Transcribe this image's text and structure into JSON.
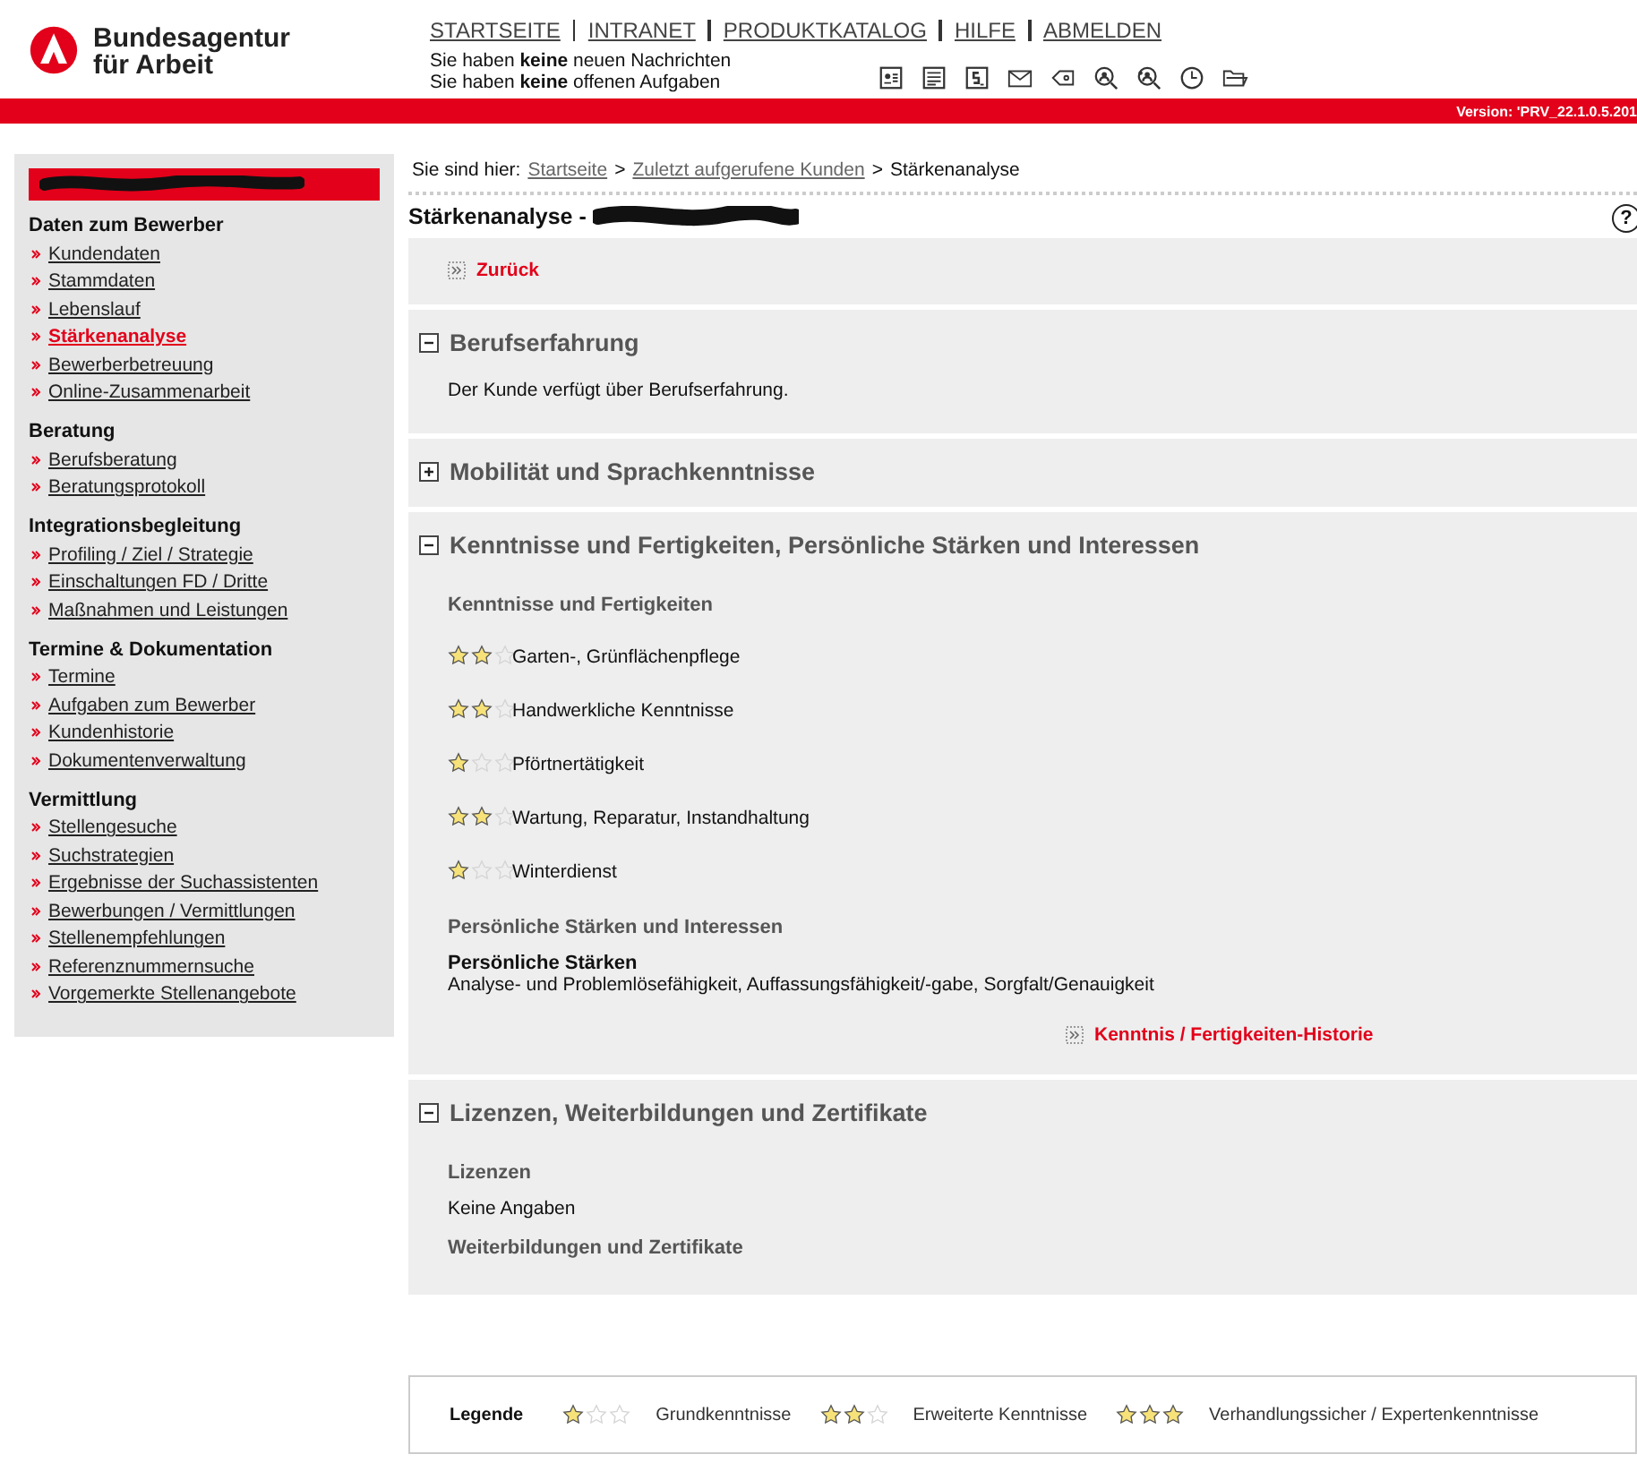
{
  "logo": {
    "line1": "Bundesagentur",
    "line2": "für Arbeit"
  },
  "top_nav": [
    "STARTSEITE",
    "INTRANET",
    "PRODUKTKATALOG",
    "HILFE",
    "ABMELDEN"
  ],
  "messages": [
    "Sie haben **keine** neuen Nachrichten",
    "Sie haben **keine** offenen Aufgaben"
  ],
  "version": "Version: 'PRV_22.1.0.5.201",
  "sidebar": {
    "groups": [
      {
        "title": "Daten zum Bewerber",
        "items": [
          {
            "label": "Kundendaten",
            "selected": false
          },
          {
            "label": "Stammdaten",
            "selected": false
          },
          {
            "label": "Lebenslauf",
            "selected": false
          },
          {
            "label": "Stärkenanalyse",
            "selected": true
          },
          {
            "label": "Bewerberbetreuung",
            "selected": false
          },
          {
            "label": "Online-Zusammenarbeit",
            "selected": false
          }
        ]
      },
      {
        "title": "Beratung",
        "items": [
          {
            "label": "Berufsberatung",
            "selected": false
          },
          {
            "label": "Beratungsprotokoll",
            "selected": false
          }
        ]
      },
      {
        "title": "Integrationsbegleitung",
        "items": [
          {
            "label": "Profiling / Ziel / Strategie",
            "selected": false
          },
          {
            "label": "Einschaltungen FD / Dritte",
            "selected": false
          },
          {
            "label": "Maßnahmen und Leistungen",
            "selected": false
          }
        ]
      },
      {
        "title": "Termine & Dokumentation",
        "items": [
          {
            "label": "Termine",
            "selected": false
          },
          {
            "label": "Aufgaben zum Bewerber",
            "selected": false
          },
          {
            "label": "Kundenhistorie",
            "selected": false
          },
          {
            "label": "Dokumentenverwaltung",
            "selected": false
          }
        ]
      },
      {
        "title": "Vermittlung",
        "items": [
          {
            "label": "Stellengesuche",
            "selected": false
          },
          {
            "label": "Suchstrategien",
            "selected": false
          },
          {
            "label": "Ergebnisse der Suchassistenten",
            "selected": false
          },
          {
            "label": "Bewerbungen / Vermittlungen",
            "selected": false
          },
          {
            "label": "Stellenempfehlungen",
            "selected": false
          },
          {
            "label": "Referenznummernsuche",
            "selected": false
          },
          {
            "label": "Vorgemerkte Stellenangebote",
            "selected": false
          }
        ]
      }
    ]
  },
  "breadcrumb": {
    "prefix": "Sie sind hier:",
    "links": [
      "Startseite",
      "Zuletzt aufgerufene Kunden"
    ],
    "separator": ">",
    "current": "Stärkenanalyse"
  },
  "page_title": "Stärkenanalyse -",
  "help": "?",
  "back_link": "Zurück",
  "sections": [
    {
      "title": "Berufserfahrung",
      "expanded": true,
      "blocks": [
        {
          "kind": "text",
          "text": "Der Kunde verfügt über Berufserfahrung."
        }
      ]
    },
    {
      "title": "Mobilität und Sprachkenntnisse",
      "expanded": false
    },
    {
      "title": "Kenntnisse und Fertigkeiten, Persönliche Stärken und Interessen",
      "expanded": true,
      "blocks": [
        {
          "kind": "heading",
          "text": "Kenntnisse und Fertigkeiten"
        },
        {
          "kind": "skill",
          "text": "Garten-, Grünflächenpflege",
          "stars": 2
        },
        {
          "kind": "skill",
          "text": "Handwerkliche Kenntnisse",
          "stars": 2
        },
        {
          "kind": "skill",
          "text": "Pförtnertätigkeit",
          "stars": 1
        },
        {
          "kind": "skill",
          "text": "Wartung, Reparatur, Instandhaltung",
          "stars": 2
        },
        {
          "kind": "skill",
          "text": "Winterdienst",
          "stars": 1
        },
        {
          "kind": "heading",
          "text": "Persönliche Stärken und Interessen"
        },
        {
          "kind": "subheading",
          "text": "Persönliche Stärken"
        },
        {
          "kind": "plain",
          "text": "Analyse- und Problemlösefähigkeit, Auffassungsfähigkeit/-gabe, Sorgfalt/Genauigkeit"
        },
        {
          "kind": "link",
          "text": "Kenntnis / Fertigkeiten-Historie"
        }
      ]
    },
    {
      "title": "Lizenzen, Weiterbildungen und Zertifikate",
      "expanded": true,
      "blocks": [
        {
          "kind": "heading",
          "text": "Lizenzen"
        },
        {
          "kind": "text",
          "text": "Keine Angaben"
        },
        {
          "kind": "heading",
          "text": "Weiterbildungen und Zertifikate"
        }
      ]
    }
  ],
  "legend": {
    "title": "Legende",
    "items": [
      {
        "label": "Grundkenntnisse",
        "stars": 1
      },
      {
        "label": "Erweiterte Kenntnisse",
        "stars": 2
      },
      {
        "label": "Verhandlungssicher / Expertenkenntnisse",
        "stars": 3
      }
    ]
  }
}
